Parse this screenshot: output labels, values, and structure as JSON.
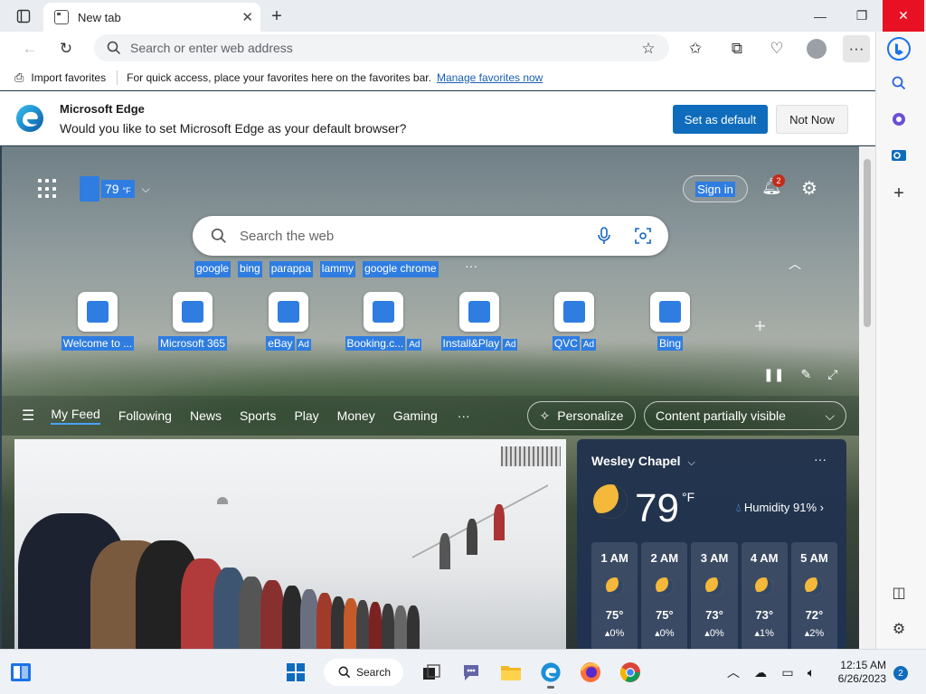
{
  "browser": {
    "tab_title": "New tab",
    "address_placeholder": "Search or enter web address",
    "favorites_bar": {
      "import_label": "Import favorites",
      "message": "For quick access, place your favorites here on the favorites bar.",
      "manage_link": "Manage favorites now"
    },
    "infobar": {
      "title": "Microsoft Edge",
      "message": "Would you like to set Microsoft Edge as your default browser?",
      "primary_button": "Set as default",
      "secondary_button": "Not Now"
    }
  },
  "ntp": {
    "weather_mini": {
      "temp": "79",
      "unit": "°F"
    },
    "sign_in": "Sign in",
    "notification_count": "2",
    "search_placeholder": "Search the web",
    "trending": [
      "google",
      "bing",
      "parappa",
      "lammy",
      "google chrome"
    ],
    "quick_links": [
      {
        "label": "Welcome to ...",
        "ad": ""
      },
      {
        "label": "Microsoft 365",
        "ad": ""
      },
      {
        "label": "eBay",
        "ad": "Ad"
      },
      {
        "label": "Booking.c...",
        "ad": "Ad"
      },
      {
        "label": "Install&Play",
        "ad": "Ad"
      },
      {
        "label": "QVC",
        "ad": "Ad"
      },
      {
        "label": "Bing",
        "ad": ""
      }
    ],
    "feed_tabs": [
      "My Feed",
      "Following",
      "News",
      "Sports",
      "Play",
      "Money",
      "Gaming"
    ],
    "personalize": "Personalize",
    "content_visibility": "Content partially visible",
    "weather": {
      "location": "Wesley Chapel",
      "temp": "79",
      "unit": "°F",
      "humidity": "Humidity 91%",
      "hourly": [
        {
          "time": "1 AM",
          "temp": "75°",
          "precip": "0%"
        },
        {
          "time": "2 AM",
          "temp": "75°",
          "precip": "0%"
        },
        {
          "time": "3 AM",
          "temp": "73°",
          "precip": "0%"
        },
        {
          "time": "4 AM",
          "temp": "73°",
          "precip": "1%"
        },
        {
          "time": "5 AM",
          "temp": "72°",
          "precip": "2%"
        }
      ]
    }
  },
  "taskbar": {
    "search_label": "Search",
    "time": "12:15 AM",
    "date": "6/26/2023",
    "notification_count": "2"
  },
  "colors": {
    "accent": "#0f6cbd",
    "close_red": "#e81123",
    "highlight": "#2f7de0"
  }
}
